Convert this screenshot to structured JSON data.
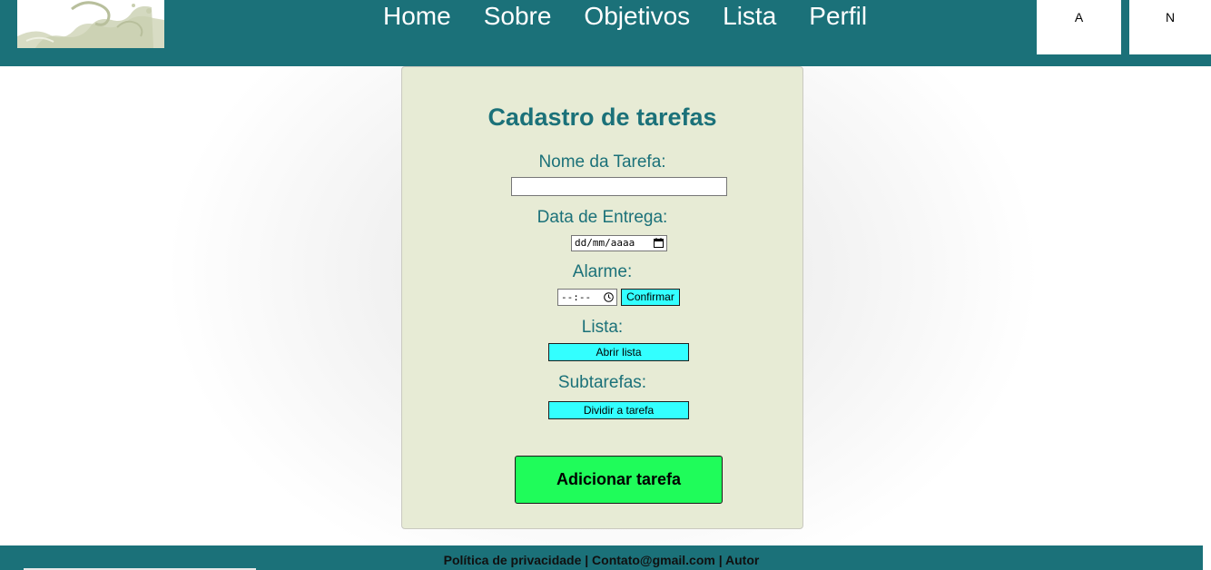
{
  "nav": {
    "items": [
      {
        "label": "Home"
      },
      {
        "label": "Sobre"
      },
      {
        "label": "Objetivos"
      },
      {
        "label": "Lista"
      },
      {
        "label": "Perfil"
      }
    ]
  },
  "header_buttons": {
    "a_label": "A",
    "n_label": "N"
  },
  "form": {
    "title": "Cadastro de tarefas",
    "task_name_label": "Nome da Tarefa:",
    "task_name_value": "",
    "due_date_label": "Data de Entrega:",
    "due_date_placeholder": "dd/mm/aaaa",
    "alarm_label": "Alarme:",
    "alarm_placeholder": "--:--",
    "confirm_label": "Confirmar",
    "list_label": "Lista:",
    "open_list_label": "Abrir lista",
    "subtasks_label": "Subtarefas:",
    "split_task_label": "Dividir a tarefa",
    "add_task_label": "Adicionar tarefa"
  },
  "footer": {
    "text": "Política de privacidade | Contato@gmail.com | Autor"
  },
  "colors": {
    "header_bg": "#1b7179",
    "card_bg": "#e7ebd5",
    "accent_text": "#1b7179",
    "small_button_bg": "#33ffff",
    "add_button_bg": "#1ffc5a"
  },
  "icons": {
    "logo": "wave-logo",
    "date_picker": "calendar-icon",
    "time_picker": "clock-icon"
  }
}
